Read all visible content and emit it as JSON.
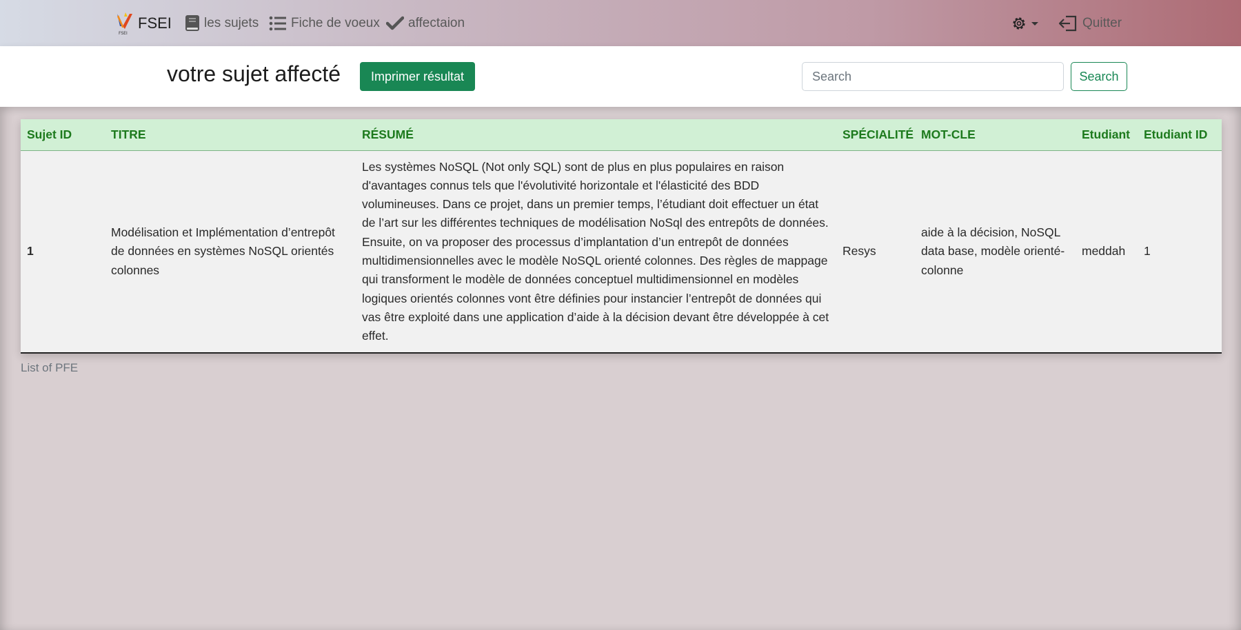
{
  "navbar": {
    "brand": "FSEI",
    "links": [
      {
        "label": "les sujets",
        "icon": "book-icon"
      },
      {
        "label": "Fiche de voeux",
        "icon": "list-icon"
      },
      {
        "label": "affectaion",
        "icon": "check-icon"
      }
    ],
    "settings_icon": "gear-icon",
    "quit_label": "Quitter",
    "quit_icon": "logout-icon"
  },
  "header": {
    "title": "votre sujet affecté",
    "print_button": "Imprimer résultat",
    "search_placeholder": "Search",
    "search_button": "Search"
  },
  "table": {
    "columns": [
      "Sujet ID",
      "TITRE",
      "RÉSUMÉ",
      "SPÉCIALITÉ",
      "MOT-CLE",
      "Etudiant",
      "Etudiant ID"
    ],
    "rows": [
      {
        "sujet_id": "1",
        "titre": "Modélisation et Implémentation d’entrepôt de données en systèmes NoSQL orientés colonnes",
        "resume": "Les systèmes NoSQL (Not only SQL) sont de plus en plus populaires en raison d'avantages connus tels que l'évolutivité horizontale et l'élasticité des BDD volumineuses. Dans ce projet, dans un premier temps, l’étudiant doit effectuer un état de l’art sur les différentes techniques de modélisation NoSql des entrepôts de données. Ensuite, on va proposer des processus d’implantation d’un entrepôt de données multidimensionnelles avec le modèle NoSQL orienté colonnes. Des règles de mappage qui transforment le modèle de données conceptuel multidimensionnel en modèles logiques orientés colonnes vont être définies pour instancier l’entrepôt de données qui vas être exploité dans une application d’aide à la décision devant être développée à cet effet.",
        "specialite": "Resys",
        "mot_cle": "aide à la décision, NoSQL data base, modèle orienté-colonne",
        "etudiant": "meddah",
        "etudiant_id": "1"
      }
    ],
    "caption": "List of PFE"
  },
  "colors": {
    "accent_green": "#198754",
    "header_row_bg": "#d1f0d5",
    "header_text": "#1d7a1d"
  }
}
